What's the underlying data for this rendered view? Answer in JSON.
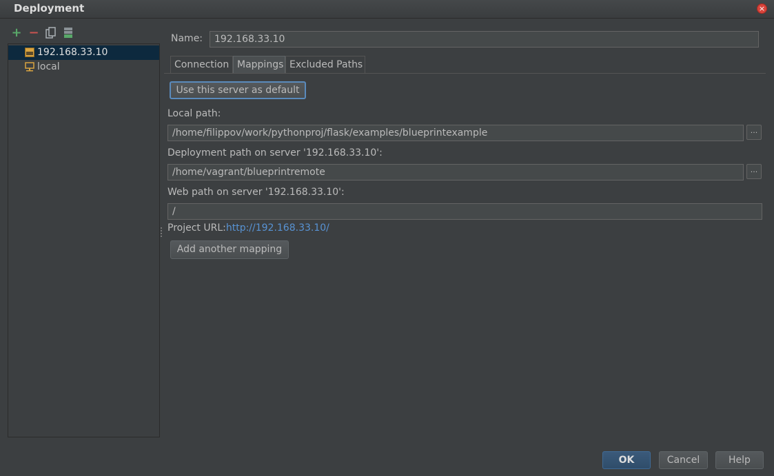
{
  "window": {
    "title": "Deployment",
    "close_icon": "close-icon"
  },
  "toolbar": {
    "add_icon": "plus-icon",
    "remove_icon": "minus-icon",
    "copy_icon": "copy-icon",
    "default_icon": "set-default-icon"
  },
  "servers": [
    {
      "name": "192.168.33.10",
      "icon": "sftp-server-icon",
      "selected": true
    },
    {
      "name": "local",
      "icon": "local-server-icon",
      "selected": false
    }
  ],
  "form": {
    "name_label": "Name:",
    "name_value": "192.168.33.10"
  },
  "tabs": [
    {
      "label": "Connection",
      "active": false
    },
    {
      "label": "Mappings",
      "active": true
    },
    {
      "label": "Excluded Paths",
      "active": false
    }
  ],
  "mappings": {
    "default_button": "Use this server as default",
    "local_path_label": "Local path:",
    "local_path_value": "/home/filippov/work/pythonproj/flask/examples/blueprintexample",
    "deployment_path_label": "Deployment path on server '192.168.33.10':",
    "deployment_path_value": "/home/vagrant/blueprintremote",
    "web_path_label": "Web path on server '192.168.33.10':",
    "web_path_value": "/",
    "project_url_label": "Project URL:",
    "project_url_value": "http://192.168.33.10/",
    "add_mapping_button": "Add another mapping",
    "browse_label": "..."
  },
  "footer": {
    "ok": "OK",
    "cancel": "Cancel",
    "help": "Help"
  },
  "colors": {
    "background": "#3c3f41",
    "selection": "#0d293e",
    "link": "#5893d4",
    "add_green": "#59a869",
    "remove_red": "#c75450"
  }
}
